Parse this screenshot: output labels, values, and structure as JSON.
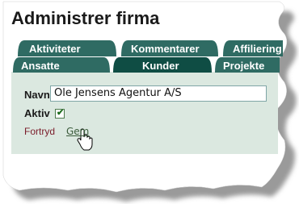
{
  "page": {
    "title": "Administrer firma"
  },
  "tabs_back_row": [
    {
      "label": "Aktiviteter"
    },
    {
      "label": "Kommentarer"
    },
    {
      "label": "Affiliering"
    }
  ],
  "tabs_front_row": [
    {
      "label": "Ansatte"
    },
    {
      "label": "Kunder",
      "active": true
    },
    {
      "label": "Projekte"
    }
  ],
  "form": {
    "name_label": "Navn",
    "name_value": "Ole Jensens Agentur A/S",
    "active_label": "Aktiv",
    "active_checked": true,
    "cancel_label": "Fortryd",
    "save_label": "Gem"
  },
  "icons": {
    "cursor": "hand-pointer-icon"
  },
  "colors": {
    "tab": "#2f6b63",
    "tab_active": "#0f4d44",
    "panel": "#dbe8e0"
  }
}
